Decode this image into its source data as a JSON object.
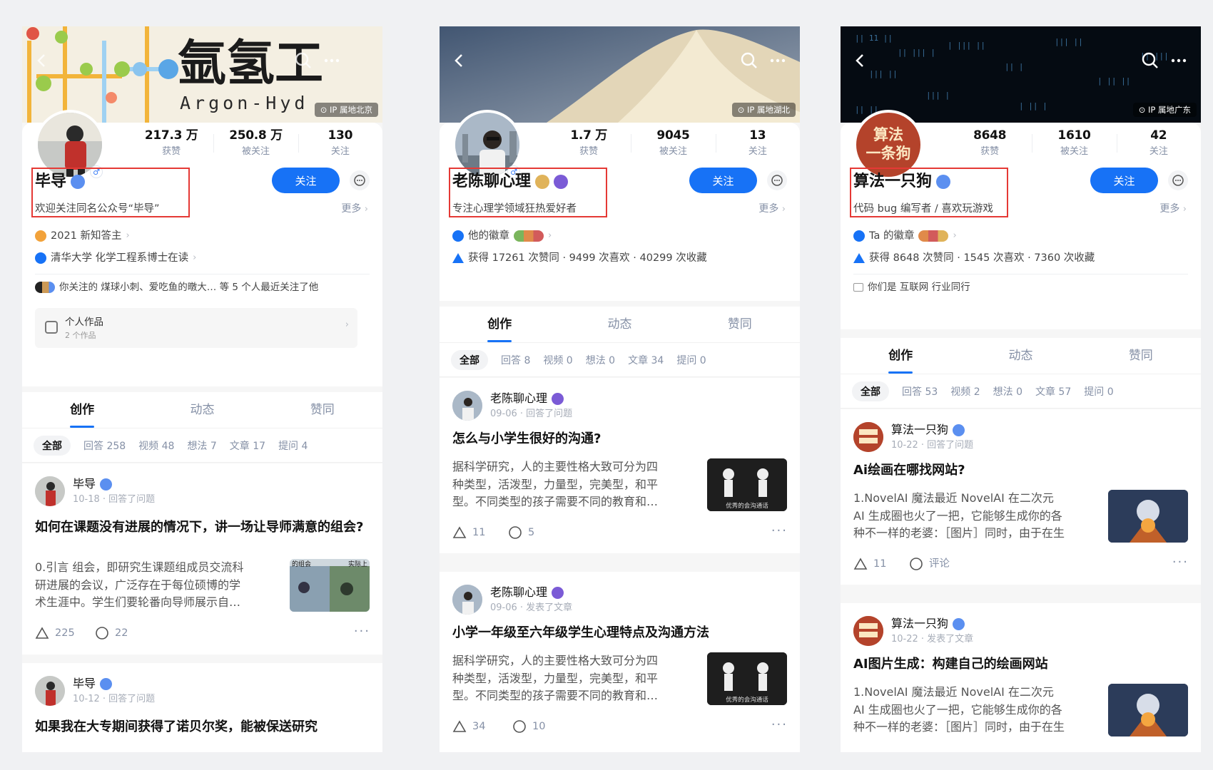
{
  "profiles": [
    {
      "ip": "IP 属地北京",
      "stats": [
        {
          "num": "217.3 万",
          "label": "获赞"
        },
        {
          "num": "250.8 万",
          "label": "被关注"
        },
        {
          "num": "130",
          "label": "关注"
        }
      ],
      "name": "毕导",
      "bio": "欢迎关注同名公众号“毕导”",
      "follow": "关注",
      "more": "更多",
      "meta": {
        "honor": "2021 新知答主",
        "edu": "清华大学 化学工程系博士在读",
        "mutual": "你关注的 煤球小刺、爱吃鱼的暾大… 等 5 个人最近关注了他",
        "works_title": "个人作品",
        "works_count": "2 个作品"
      },
      "banner_text": "Argon-Hyd",
      "tabs": [
        "创作",
        "动态",
        "赞同"
      ],
      "filters": [
        "全部",
        "回答 258",
        "视频 48",
        "想法 7",
        "文章 17",
        "提问 4"
      ],
      "feed": [
        {
          "author": "毕导",
          "date": "10-18 · 回答了问题",
          "title": "如何在课题没有进展的情况下，讲一场让导师满意的组会?",
          "body": "0.引言 组会，即研究生课题组成员交流科研进展的会议，广泛存在于每位硕博的学术生涯中。学生们要轮番向导师展示自…",
          "likes": "225",
          "comments": "22",
          "thumb_tag1": "的组会",
          "thumb_tag2": "实际上"
        },
        {
          "author": "毕导",
          "date": "10-12 · 回答了问题",
          "title": "如果我在大专期间获得了诺贝尔奖，能被保送研究"
        }
      ]
    },
    {
      "ip": "IP 属地湖北",
      "stats": [
        {
          "num": "1.7 万",
          "label": "获赞"
        },
        {
          "num": "9045",
          "label": "被关注"
        },
        {
          "num": "13",
          "label": "关注"
        }
      ],
      "name": "老陈聊心理",
      "bio": "专注心理学领域狂热爱好者",
      "follow": "关注",
      "more": "更多",
      "meta": {
        "honor": "他的徽章",
        "stats_line": "获得 17261 次赞同 · 9499 次喜欢 · 40299 次收藏"
      },
      "tabs": [
        "创作",
        "动态",
        "赞同"
      ],
      "filters": [
        "全部",
        "回答 8",
        "视频 0",
        "想法 0",
        "文章 34",
        "提问 0"
      ],
      "feed": [
        {
          "author": "老陈聊心理",
          "date": "09-06 · 回答了问题",
          "title": "怎么与小学生很好的沟通?",
          "body": "据科学研究，人的主要性格大致可分为四种类型，活泼型，力量型，完美型，和平型。不同类型的孩子需要不同的教育和…",
          "likes": "11",
          "comments": "5",
          "thumb_caption": "优秀的会沟通话"
        },
        {
          "author": "老陈聊心理",
          "date": "09-06 · 发表了文章",
          "title": "小学一年级至六年级学生心理特点及沟通方法",
          "body": "据科学研究，人的主要性格大致可分为四种类型，活泼型，力量型，完美型，和平型。不同类型的孩子需要不同的教育和…",
          "likes": "34",
          "comments": "10",
          "thumb_caption": "优秀的会沟通话"
        }
      ]
    },
    {
      "ip": "IP 属地广东",
      "stats": [
        {
          "num": "8648",
          "label": "获赞"
        },
        {
          "num": "1610",
          "label": "被关注"
        },
        {
          "num": "42",
          "label": "关注"
        }
      ],
      "name": "算法一只狗",
      "avatar_text": "算法\n一条狗",
      "bio": "代码 bug 编写者 / 喜欢玩游戏",
      "follow": "关注",
      "more": "更多",
      "meta": {
        "honor": "Ta 的徽章",
        "stats_line": "获得 8648 次赞同 · 1545 次喜欢 · 7360 次收藏",
        "industry": "你们是 互联网 行业同行"
      },
      "tabs": [
        "创作",
        "动态",
        "赞同"
      ],
      "filters": [
        "全部",
        "回答 53",
        "视频 2",
        "想法 0",
        "文章 57",
        "提问 0"
      ],
      "feed": [
        {
          "author": "算法一只狗",
          "date": "10-22 · 回答了问题",
          "title": "Ai绘画在哪找网站?",
          "body": "1.NovelAI 魔法最近 NovelAI 在二次元 AI 生成圈也火了一把，它能够生成你的各种不一样的老婆：［图片］同时，由于在生成…",
          "likes": "11",
          "comments": "评论"
        },
        {
          "author": "算法一只狗",
          "date": "10-22 · 发表了文章",
          "title": "AI图片生成：构建自己的绘画网站",
          "body": "1.NovelAI 魔法最近 NovelAI 在二次元 AI 生成圈也火了一把，它能够生成你的各种不一样的老婆：［图片］同时，由于在生成…"
        }
      ]
    }
  ],
  "colors": {
    "accent": "#1772f6",
    "highlight_box": "#e53935",
    "muted": "#8590a6"
  }
}
